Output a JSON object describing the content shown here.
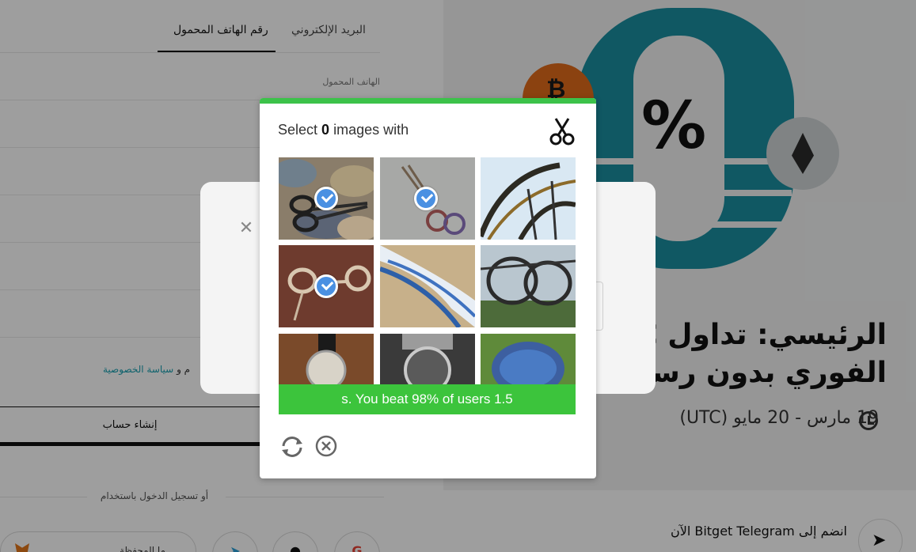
{
  "form": {
    "tabs": [
      {
        "label": "البريد الإلكتروني",
        "active": false
      },
      {
        "label": "رقم الهاتف المحمول",
        "active": true
      }
    ],
    "phone_label": "الهاتف المحمول",
    "privacy_prefix": "م و",
    "privacy_link": "سياسة الخصوصية",
    "create_button": "إنشاء حساب",
    "or_login_with": "أو تسجيل الدخول باستخدام",
    "wallet_partial": "ما المحفظة"
  },
  "promo": {
    "title_line1": "الرئيسي: تداول C",
    "title_line2": "الفوري بدون رسو",
    "date": "19 مارس - 20 مايو (UTC)",
    "telegram_prefix": "انضم إلى",
    "telegram_brand": "Bitget Telegram",
    "telegram_suffix": "الآن",
    "percent_symbol": "%",
    "btc_symbol": "₿"
  },
  "captcha": {
    "prompt_prefix": "Select",
    "prompt_count": "0",
    "prompt_suffix": "images with",
    "result_text": "s. You beat 98% of users 1.5",
    "accent_color": "#3cc43c",
    "check_color": "#4a90e2",
    "tiles": [
      {
        "subject": "scissors on camo fabric",
        "selected": true
      },
      {
        "subject": "small scissors on gray",
        "selected": true
      },
      {
        "subject": "roller coaster",
        "selected": false
      },
      {
        "subject": "scissors on brown leather",
        "selected": true
      },
      {
        "subject": "blue roller coaster track",
        "selected": false
      },
      {
        "subject": "roller coaster loops",
        "selected": false
      },
      {
        "subject": "wristwatch on wood",
        "selected": false
      },
      {
        "subject": "chronograph watch",
        "selected": false
      },
      {
        "subject": "turtle",
        "selected": false
      }
    ]
  }
}
